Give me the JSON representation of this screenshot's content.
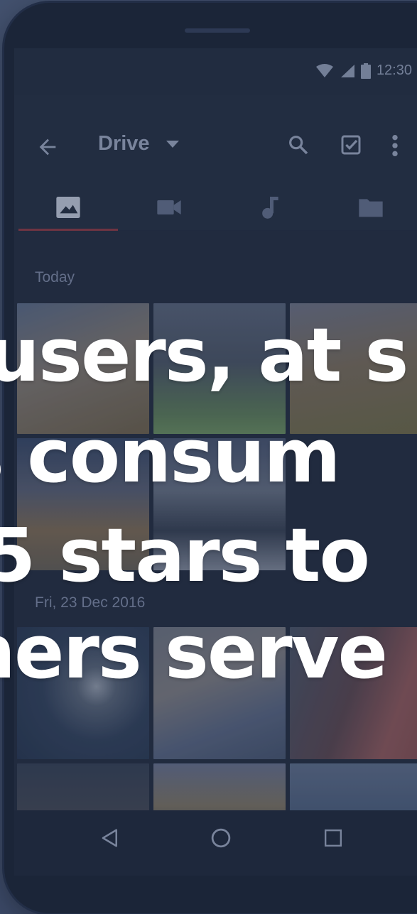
{
  "status_bar": {
    "time": "12:30"
  },
  "app_bar": {
    "title": "Drive",
    "icons": [
      "back-icon",
      "dropdown-icon",
      "search-icon",
      "select-icon",
      "more-icon"
    ]
  },
  "tabs": [
    {
      "name": "photos",
      "icon": "image-icon",
      "selected": true
    },
    {
      "name": "videos",
      "icon": "video-icon",
      "selected": false
    },
    {
      "name": "music",
      "icon": "music-icon",
      "selected": false
    },
    {
      "name": "folders",
      "icon": "folder-icon",
      "selected": false
    }
  ],
  "sections": [
    {
      "label": "Today"
    },
    {
      "label": "Fri, 23 Dec 2016"
    }
  ],
  "overlay": {
    "line1": "users, at s",
    "line2": "s consum",
    "line3": "5 stars to",
    "line4": "ners serve"
  },
  "colors": {
    "accent": "#7a2f3a",
    "screen_bg": "#1a2336",
    "overlay_tint": "#3d4b6a"
  }
}
